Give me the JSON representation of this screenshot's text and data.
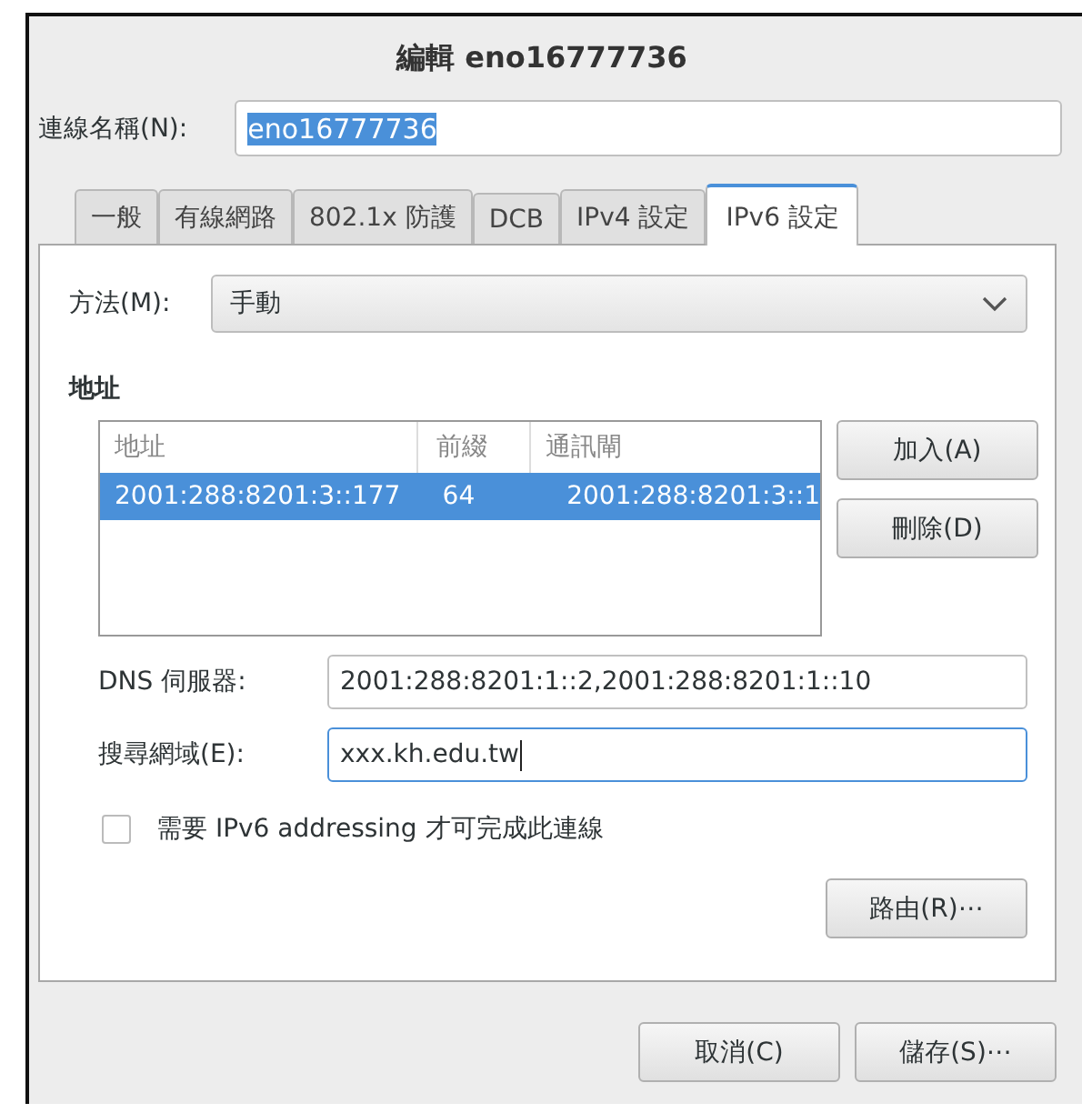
{
  "window": {
    "title": "編輯 eno16777736"
  },
  "connection_name": {
    "label": "連線名稱(N):",
    "value": "eno16777736"
  },
  "tabs": [
    {
      "label": "一般",
      "selected": false
    },
    {
      "label": "有線網路",
      "selected": false
    },
    {
      "label": "802.1x 防護",
      "selected": false
    },
    {
      "label": "DCB",
      "selected": false
    },
    {
      "label": "IPv4 設定",
      "selected": false
    },
    {
      "label": "IPv6 設定",
      "selected": true
    }
  ],
  "method": {
    "label": "方法(M):",
    "value": "手動"
  },
  "addresses": {
    "heading": "地址",
    "columns": [
      "地址",
      "前綴",
      "通訊閘"
    ],
    "rows": [
      {
        "cells": [
          "2001:288:8201:3::177",
          "64",
          "2001:288:8201:3::1"
        ],
        "selected": true
      }
    ],
    "buttons": [
      "加入(A)",
      "刪除(D)"
    ]
  },
  "dns": {
    "label": "DNS 伺服器:",
    "value": "2001:288:8201:1::2,2001:288:8201:1::10"
  },
  "search_domains": {
    "label": "搜尋網域(E):",
    "value": "xxx.kh.edu.tw",
    "focused": true
  },
  "require_ipv6": {
    "label": "需要 IPv6 addressing 才可完成此連線",
    "checked": false
  },
  "routes_button": "路由(R)⋯",
  "buttons": [
    "取消(C)",
    "儲存(S)⋯"
  ]
}
